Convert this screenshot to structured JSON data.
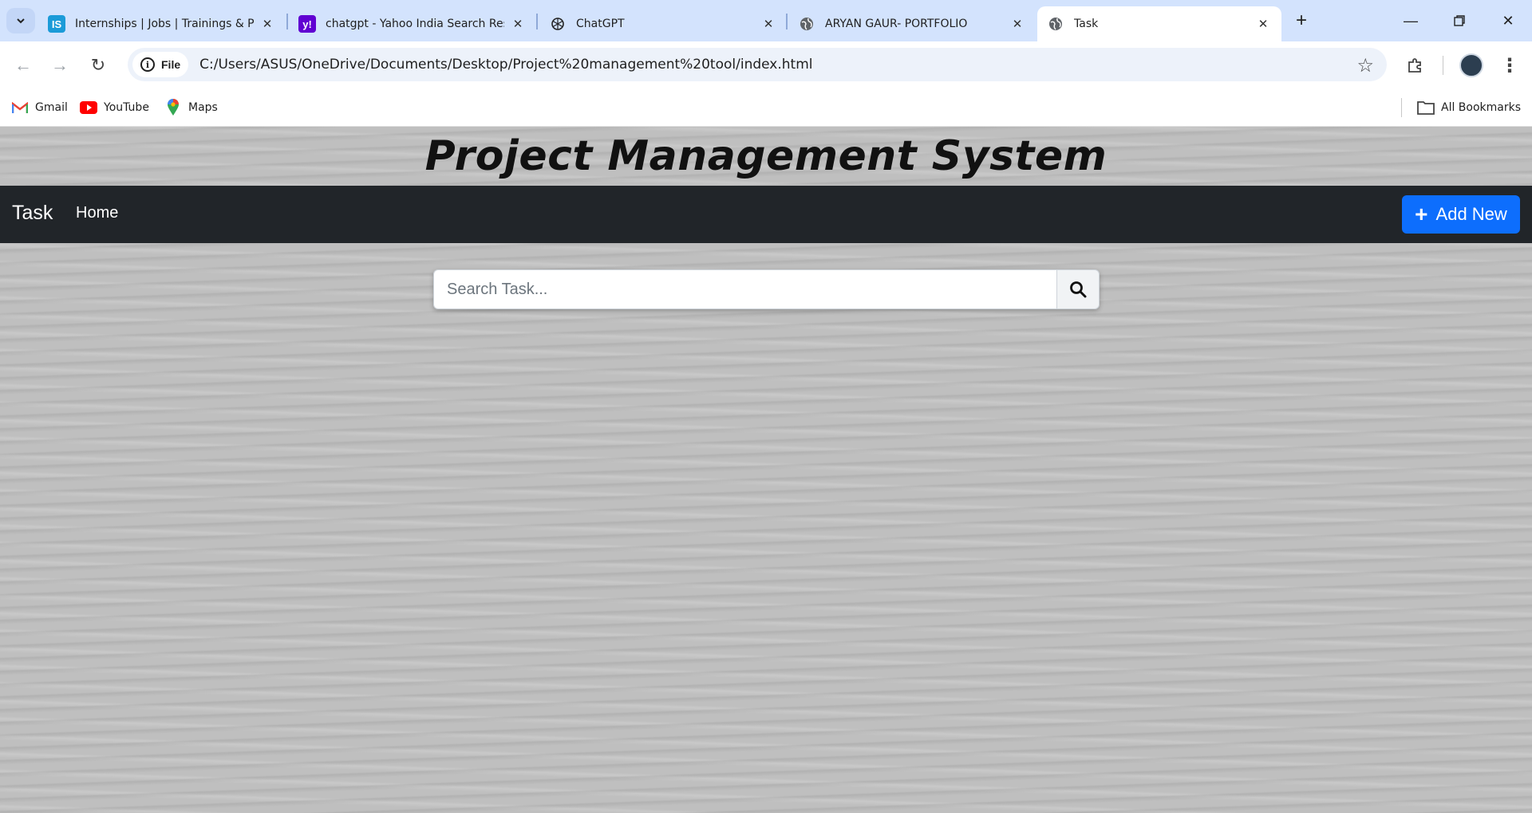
{
  "browser": {
    "tabs": [
      {
        "title": "Internships | Jobs | Trainings & Pla",
        "favicon": "internshala-icon",
        "favicon_text": "IS",
        "color": "#1b9bd8",
        "active": false
      },
      {
        "title": "chatgpt - Yahoo India Search Resu",
        "favicon": "yahoo-icon",
        "favicon_text": "y!",
        "color": "#6001d2",
        "active": false
      },
      {
        "title": "ChatGPT",
        "favicon": "chatgpt-icon",
        "active": false
      },
      {
        "title": "ARYAN GAUR- PORTFOLIO",
        "favicon": "globe-icon",
        "active": false
      },
      {
        "title": "Task",
        "favicon": "globe-icon",
        "active": true
      }
    ],
    "address": {
      "chip_label": "File",
      "url": "C:/Users/ASUS/OneDrive/Documents/Desktop/Project%20management%20tool/index.html"
    },
    "bookmarks": [
      {
        "label": "Gmail",
        "icon": "gmail-icon"
      },
      {
        "label": "YouTube",
        "icon": "youtube-icon"
      },
      {
        "label": "Maps",
        "icon": "maps-icon"
      }
    ],
    "all_bookmarks_label": "All Bookmarks"
  },
  "page": {
    "heading": "Project Management System",
    "navbar": {
      "brand": "Task",
      "home_link": "Home",
      "add_button_label": "Add New",
      "add_button_color": "#0d6efd",
      "bg_color": "#212529"
    },
    "search": {
      "placeholder": "Search Task..."
    }
  }
}
